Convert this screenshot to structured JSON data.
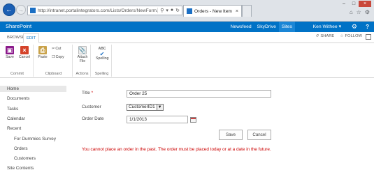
{
  "browser": {
    "address_url": "http://intranet.portalintegrators.com/Lists/Orders/NewForm.aspx?",
    "tab_title": "Orders - New Item"
  },
  "suite_bar": {
    "brand": "SharePoint",
    "links": [
      "Newsfeed",
      "SkyDrive",
      "Sites"
    ],
    "user_name": "Ken Withee ▾",
    "help_label": "?"
  },
  "ribbon_tabs": {
    "browse": "BROWSE",
    "edit": "EDIT",
    "share": "SHARE",
    "follow": "FOLLOW"
  },
  "ribbon": {
    "commit": {
      "label": "Commit",
      "save": "Save",
      "cancel": "Cancel"
    },
    "clipboard": {
      "label": "Clipboard",
      "paste": "Paste",
      "cut": "Cut",
      "copy": "Copy"
    },
    "actions": {
      "label": "Actions",
      "attach_file_line1": "Attach",
      "attach_file_line2": "File"
    },
    "spelling": {
      "label": "Spelling",
      "button": "Spelling",
      "abc": "ABC"
    }
  },
  "left_nav": {
    "home": "Home",
    "documents": "Documents",
    "tasks": "Tasks",
    "calendar": "Calendar",
    "recent": "Recent",
    "recent_items": [
      "For Dummies Survey",
      "Orders",
      "Customers"
    ],
    "site_contents": "Site Contents"
  },
  "form": {
    "title_label": "Title",
    "required_marker": "*",
    "title_value": "Order 25",
    "customer_label": "Customer",
    "customer_value": "CustomerID1",
    "order_date_label": "Order Date",
    "order_date_value": "1/1/2013",
    "save_button": "Save",
    "cancel_button": "Cancel",
    "error_message": "You cannot place an order in the past. The order must be placed today or at a date in the future."
  },
  "colors": {
    "suite_bar": "#0072c6",
    "error_text": "#cc0000",
    "save_icon": "#8b1a8b",
    "cancel_icon": "#d4432a"
  }
}
